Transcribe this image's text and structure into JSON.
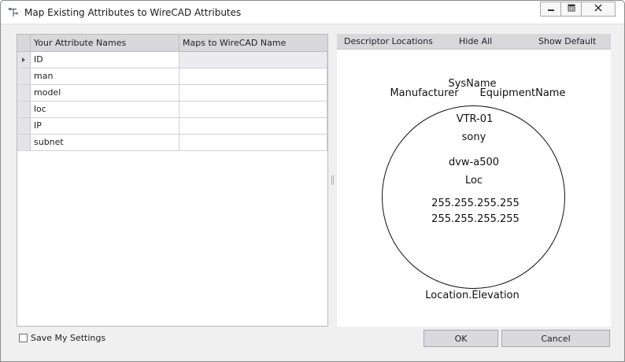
{
  "window": {
    "title": "Map Existing Attributes to WireCAD Attributes"
  },
  "grid": {
    "columns": [
      "Your Attribute Names",
      "Maps to WireCAD Name"
    ],
    "rows": [
      {
        "name": "ID",
        "maps_to": ""
      },
      {
        "name": "man",
        "maps_to": ""
      },
      {
        "name": "model",
        "maps_to": ""
      },
      {
        "name": "loc",
        "maps_to": ""
      },
      {
        "name": "IP",
        "maps_to": ""
      },
      {
        "name": "subnet",
        "maps_to": ""
      }
    ],
    "selected_row": 0
  },
  "descriptor_panel": {
    "tabs": [
      "Descriptor Locations",
      "Hide All",
      "Show Default"
    ],
    "labels": {
      "sys_name": "SysName",
      "manufacturer": "Manufacturer",
      "equipment_name": "EquipmentName",
      "id_value": "VTR-01",
      "manufacturer_value": "sony",
      "model_value": "dvw-a500",
      "loc_value": "Loc",
      "ip_value": "255.255.255.255",
      "subnet_value": "255.255.255.255",
      "location_elevation": "Location.Elevation"
    }
  },
  "footer": {
    "save_settings_label": "Save My Settings",
    "save_settings_checked": false,
    "ok_label": "OK",
    "cancel_label": "Cancel"
  },
  "icons": {
    "app": "mapping-tool-icon",
    "minimize": "minimize-icon",
    "maximize": "maximize-icon",
    "close": "close-icon",
    "row_indicator": "row-pointer-icon"
  }
}
